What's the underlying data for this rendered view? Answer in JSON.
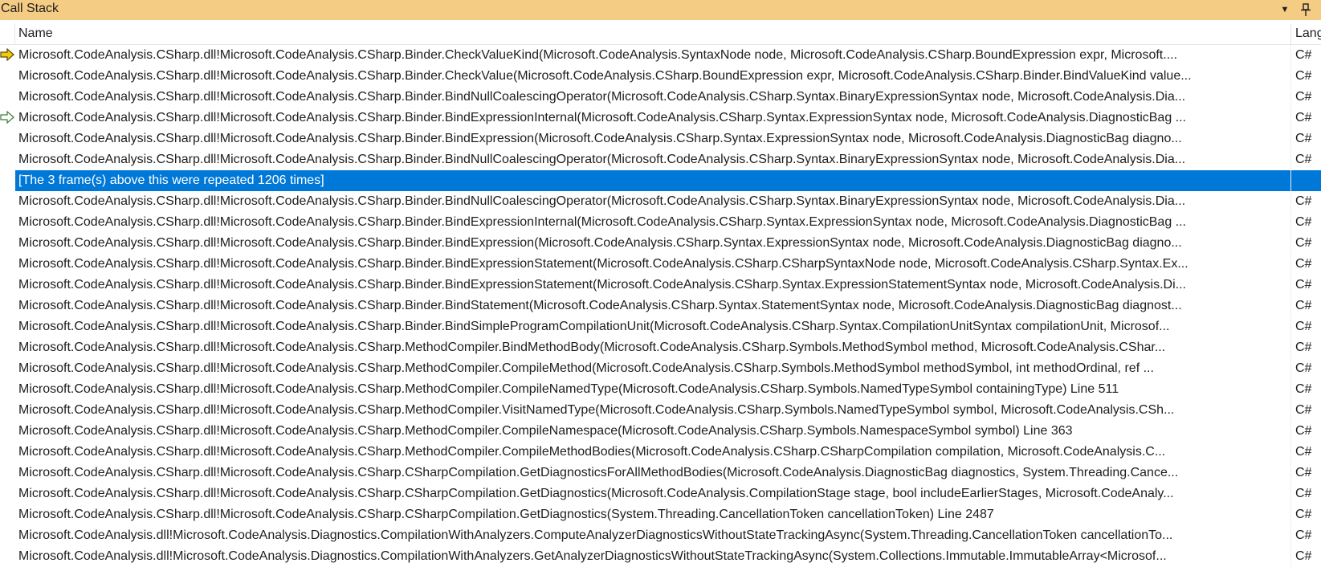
{
  "window": {
    "title": "Call Stack",
    "dropdown_icon": "chevron-down-icon",
    "pin_icon": "pin-icon"
  },
  "columns": {
    "name": "Name",
    "language": "Lang"
  },
  "rows": [
    {
      "name": "Microsoft.CodeAnalysis.CSharp.dll!Microsoft.CodeAnalysis.CSharp.Binder.CheckValueKind(Microsoft.CodeAnalysis.SyntaxNode node, Microsoft.CodeAnalysis.CSharp.BoundExpression expr, Microsoft....",
      "language": "C#",
      "marker": "current-frame-arrow-icon"
    },
    {
      "name": "Microsoft.CodeAnalysis.CSharp.dll!Microsoft.CodeAnalysis.CSharp.Binder.CheckValue(Microsoft.CodeAnalysis.CSharp.BoundExpression expr, Microsoft.CodeAnalysis.CSharp.Binder.BindValueKind value...",
      "language": "C#",
      "marker": ""
    },
    {
      "name": "Microsoft.CodeAnalysis.CSharp.dll!Microsoft.CodeAnalysis.CSharp.Binder.BindNullCoalescingOperator(Microsoft.CodeAnalysis.CSharp.Syntax.BinaryExpressionSyntax node, Microsoft.CodeAnalysis.Dia...",
      "language": "C#",
      "marker": ""
    },
    {
      "name": "Microsoft.CodeAnalysis.CSharp.dll!Microsoft.CodeAnalysis.CSharp.Binder.BindExpressionInternal(Microsoft.CodeAnalysis.CSharp.Syntax.ExpressionSyntax node, Microsoft.CodeAnalysis.DiagnosticBag ...",
      "language": "C#",
      "marker": "return-frame-arrow-icon"
    },
    {
      "name": "Microsoft.CodeAnalysis.CSharp.dll!Microsoft.CodeAnalysis.CSharp.Binder.BindExpression(Microsoft.CodeAnalysis.CSharp.Syntax.ExpressionSyntax node, Microsoft.CodeAnalysis.DiagnosticBag diagno...",
      "language": "C#",
      "marker": ""
    },
    {
      "name": "Microsoft.CodeAnalysis.CSharp.dll!Microsoft.CodeAnalysis.CSharp.Binder.BindNullCoalescingOperator(Microsoft.CodeAnalysis.CSharp.Syntax.BinaryExpressionSyntax node, Microsoft.CodeAnalysis.Dia...",
      "language": "C#",
      "marker": ""
    },
    {
      "name": "[The 3 frame(s) above this were repeated 1206 times]",
      "language": "",
      "marker": "",
      "selected": true
    },
    {
      "name": "Microsoft.CodeAnalysis.CSharp.dll!Microsoft.CodeAnalysis.CSharp.Binder.BindNullCoalescingOperator(Microsoft.CodeAnalysis.CSharp.Syntax.BinaryExpressionSyntax node, Microsoft.CodeAnalysis.Dia...",
      "language": "C#",
      "marker": ""
    },
    {
      "name": "Microsoft.CodeAnalysis.CSharp.dll!Microsoft.CodeAnalysis.CSharp.Binder.BindExpressionInternal(Microsoft.CodeAnalysis.CSharp.Syntax.ExpressionSyntax node, Microsoft.CodeAnalysis.DiagnosticBag ...",
      "language": "C#",
      "marker": ""
    },
    {
      "name": "Microsoft.CodeAnalysis.CSharp.dll!Microsoft.CodeAnalysis.CSharp.Binder.BindExpression(Microsoft.CodeAnalysis.CSharp.Syntax.ExpressionSyntax node, Microsoft.CodeAnalysis.DiagnosticBag diagno...",
      "language": "C#",
      "marker": ""
    },
    {
      "name": "Microsoft.CodeAnalysis.CSharp.dll!Microsoft.CodeAnalysis.CSharp.Binder.BindExpressionStatement(Microsoft.CodeAnalysis.CSharp.CSharpSyntaxNode node, Microsoft.CodeAnalysis.CSharp.Syntax.Ex...",
      "language": "C#",
      "marker": ""
    },
    {
      "name": "Microsoft.CodeAnalysis.CSharp.dll!Microsoft.CodeAnalysis.CSharp.Binder.BindExpressionStatement(Microsoft.CodeAnalysis.CSharp.Syntax.ExpressionStatementSyntax node, Microsoft.CodeAnalysis.Di...",
      "language": "C#",
      "marker": ""
    },
    {
      "name": "Microsoft.CodeAnalysis.CSharp.dll!Microsoft.CodeAnalysis.CSharp.Binder.BindStatement(Microsoft.CodeAnalysis.CSharp.Syntax.StatementSyntax node, Microsoft.CodeAnalysis.DiagnosticBag diagnost...",
      "language": "C#",
      "marker": ""
    },
    {
      "name": "Microsoft.CodeAnalysis.CSharp.dll!Microsoft.CodeAnalysis.CSharp.Binder.BindSimpleProgramCompilationUnit(Microsoft.CodeAnalysis.CSharp.Syntax.CompilationUnitSyntax compilationUnit, Microsof...",
      "language": "C#",
      "marker": ""
    },
    {
      "name": "Microsoft.CodeAnalysis.CSharp.dll!Microsoft.CodeAnalysis.CSharp.MethodCompiler.BindMethodBody(Microsoft.CodeAnalysis.CSharp.Symbols.MethodSymbol method, Microsoft.CodeAnalysis.CShar...",
      "language": "C#",
      "marker": ""
    },
    {
      "name": "Microsoft.CodeAnalysis.CSharp.dll!Microsoft.CodeAnalysis.CSharp.MethodCompiler.CompileMethod(Microsoft.CodeAnalysis.CSharp.Symbols.MethodSymbol methodSymbol, int methodOrdinal, ref ...",
      "language": "C#",
      "marker": ""
    },
    {
      "name": "Microsoft.CodeAnalysis.CSharp.dll!Microsoft.CodeAnalysis.CSharp.MethodCompiler.CompileNamedType(Microsoft.CodeAnalysis.CSharp.Symbols.NamedTypeSymbol containingType) Line 511",
      "language": "C#",
      "marker": ""
    },
    {
      "name": "Microsoft.CodeAnalysis.CSharp.dll!Microsoft.CodeAnalysis.CSharp.MethodCompiler.VisitNamedType(Microsoft.CodeAnalysis.CSharp.Symbols.NamedTypeSymbol symbol, Microsoft.CodeAnalysis.CSh...",
      "language": "C#",
      "marker": ""
    },
    {
      "name": "Microsoft.CodeAnalysis.CSharp.dll!Microsoft.CodeAnalysis.CSharp.MethodCompiler.CompileNamespace(Microsoft.CodeAnalysis.CSharp.Symbols.NamespaceSymbol symbol) Line 363",
      "language": "C#",
      "marker": ""
    },
    {
      "name": "Microsoft.CodeAnalysis.CSharp.dll!Microsoft.CodeAnalysis.CSharp.MethodCompiler.CompileMethodBodies(Microsoft.CodeAnalysis.CSharp.CSharpCompilation compilation, Microsoft.CodeAnalysis.C...",
      "language": "C#",
      "marker": ""
    },
    {
      "name": "Microsoft.CodeAnalysis.CSharp.dll!Microsoft.CodeAnalysis.CSharp.CSharpCompilation.GetDiagnosticsForAllMethodBodies(Microsoft.CodeAnalysis.DiagnosticBag diagnostics, System.Threading.Cance...",
      "language": "C#",
      "marker": ""
    },
    {
      "name": "Microsoft.CodeAnalysis.CSharp.dll!Microsoft.CodeAnalysis.CSharp.CSharpCompilation.GetDiagnostics(Microsoft.CodeAnalysis.CompilationStage stage, bool includeEarlierStages, Microsoft.CodeAnaly...",
      "language": "C#",
      "marker": ""
    },
    {
      "name": "Microsoft.CodeAnalysis.CSharp.dll!Microsoft.CodeAnalysis.CSharp.CSharpCompilation.GetDiagnostics(System.Threading.CancellationToken cancellationToken) Line 2487",
      "language": "C#",
      "marker": ""
    },
    {
      "name": "Microsoft.CodeAnalysis.dll!Microsoft.CodeAnalysis.Diagnostics.CompilationWithAnalyzers.ComputeAnalyzerDiagnosticsWithoutStateTrackingAsync(System.Threading.CancellationToken cancellationTo...",
      "language": "C#",
      "marker": ""
    },
    {
      "name": "Microsoft.CodeAnalysis.dll!Microsoft.CodeAnalysis.Diagnostics.CompilationWithAnalyzers.GetAnalyzerDiagnosticsWithoutStateTrackingAsync(System.Collections.Immutable.ImmutableArray<Microsof...",
      "language": "C#",
      "marker": ""
    }
  ],
  "colors": {
    "titlebar": "#f5cc84",
    "selection": "#0078d7",
    "current_arrow": "#f2c811",
    "return_arrow": "#ffffff"
  }
}
